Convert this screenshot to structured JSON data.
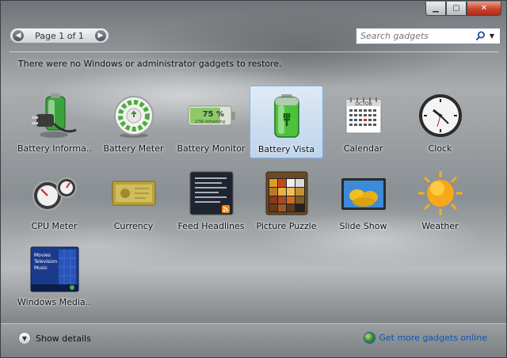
{
  "pager": {
    "prev_icon": "chevron-left-icon",
    "label": "Page 1 of 1",
    "next_icon": "chevron-right-icon"
  },
  "search": {
    "placeholder": "Search gadgets"
  },
  "message": "There were no Windows or administrator gadgets to restore.",
  "gadgets": [
    {
      "label": "Battery Informa...",
      "icon": "battery-information-icon"
    },
    {
      "label": "Battery Meter",
      "icon": "battery-meter-icon"
    },
    {
      "label": "Battery Monitor",
      "icon": "battery-monitor-icon",
      "icon_text": "75 %",
      "icon_subtext": "2:56 remaining"
    },
    {
      "label": "Battery Vista",
      "icon": "battery-vista-icon",
      "selected": true
    },
    {
      "label": "Calendar",
      "icon": "calendar-icon",
      "icon_text": "OCTOB"
    },
    {
      "label": "Clock",
      "icon": "clock-icon"
    },
    {
      "label": "CPU Meter",
      "icon": "cpu-meter-icon"
    },
    {
      "label": "Currency",
      "icon": "currency-icon"
    },
    {
      "label": "Feed Headlines",
      "icon": "feed-headlines-icon"
    },
    {
      "label": "Picture Puzzle",
      "icon": "picture-puzzle-icon"
    },
    {
      "label": "Slide Show",
      "icon": "slide-show-icon"
    },
    {
      "label": "Weather",
      "icon": "weather-icon"
    },
    {
      "label": "Windows Media...",
      "icon": "windows-media-center-icon",
      "icon_lines": [
        "Movies",
        "Television",
        "Music"
      ]
    }
  ],
  "footer": {
    "details_label": "Show details",
    "more_label": "Get more gadgets online"
  },
  "colors": {
    "selection_bg": "#c4dffc",
    "selection_border": "#84acdd",
    "link": "#0b55b8",
    "close_button": "#c8432b"
  }
}
